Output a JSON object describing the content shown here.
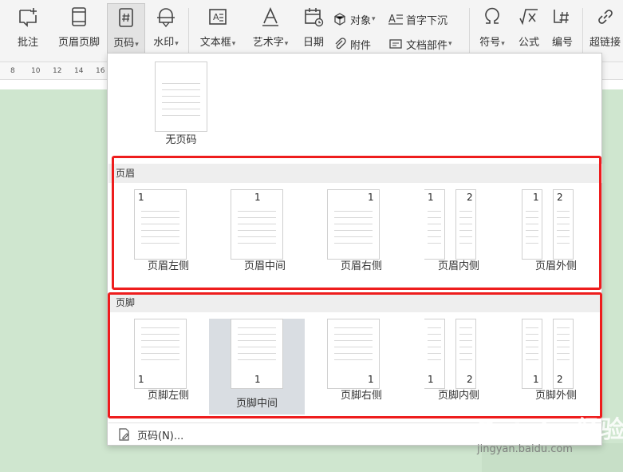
{
  "toolbar": {
    "comment": "批注",
    "header_footer": "页眉页脚",
    "page_number": "页码",
    "watermark": "水印",
    "text_box": "文本框",
    "word_art": "艺术字",
    "date": "日期",
    "object": "对象",
    "attachment": "附件",
    "drop_cap": "首字下沉",
    "doc_parts": "文档部件",
    "symbol": "符号",
    "formula": "公式",
    "numbering": "编号",
    "hyperlink": "超链接"
  },
  "ruler": [
    "8",
    "10",
    "12",
    "14",
    "16"
  ],
  "dropdown": {
    "none_label": "无页码",
    "header_section": "页眉",
    "footer_section": "页脚",
    "page_num_glyph": "1",
    "page_num_glyph_2": "2",
    "header_items": [
      "页眉左侧",
      "页眉中间",
      "页眉右侧",
      "页眉内侧",
      "页眉外侧"
    ],
    "footer_items": [
      "页脚左侧",
      "页脚中间",
      "页脚右侧",
      "页脚内侧",
      "页脚外侧"
    ],
    "more_label": "页码(N)..."
  },
  "watermark": {
    "brand": "Bai du 经验",
    "url": "jingyan.baidu.com"
  },
  "colors": {
    "highlight": "#ee1d1d",
    "hover": "#d9dde2",
    "canvas": "#cfe6cf"
  }
}
